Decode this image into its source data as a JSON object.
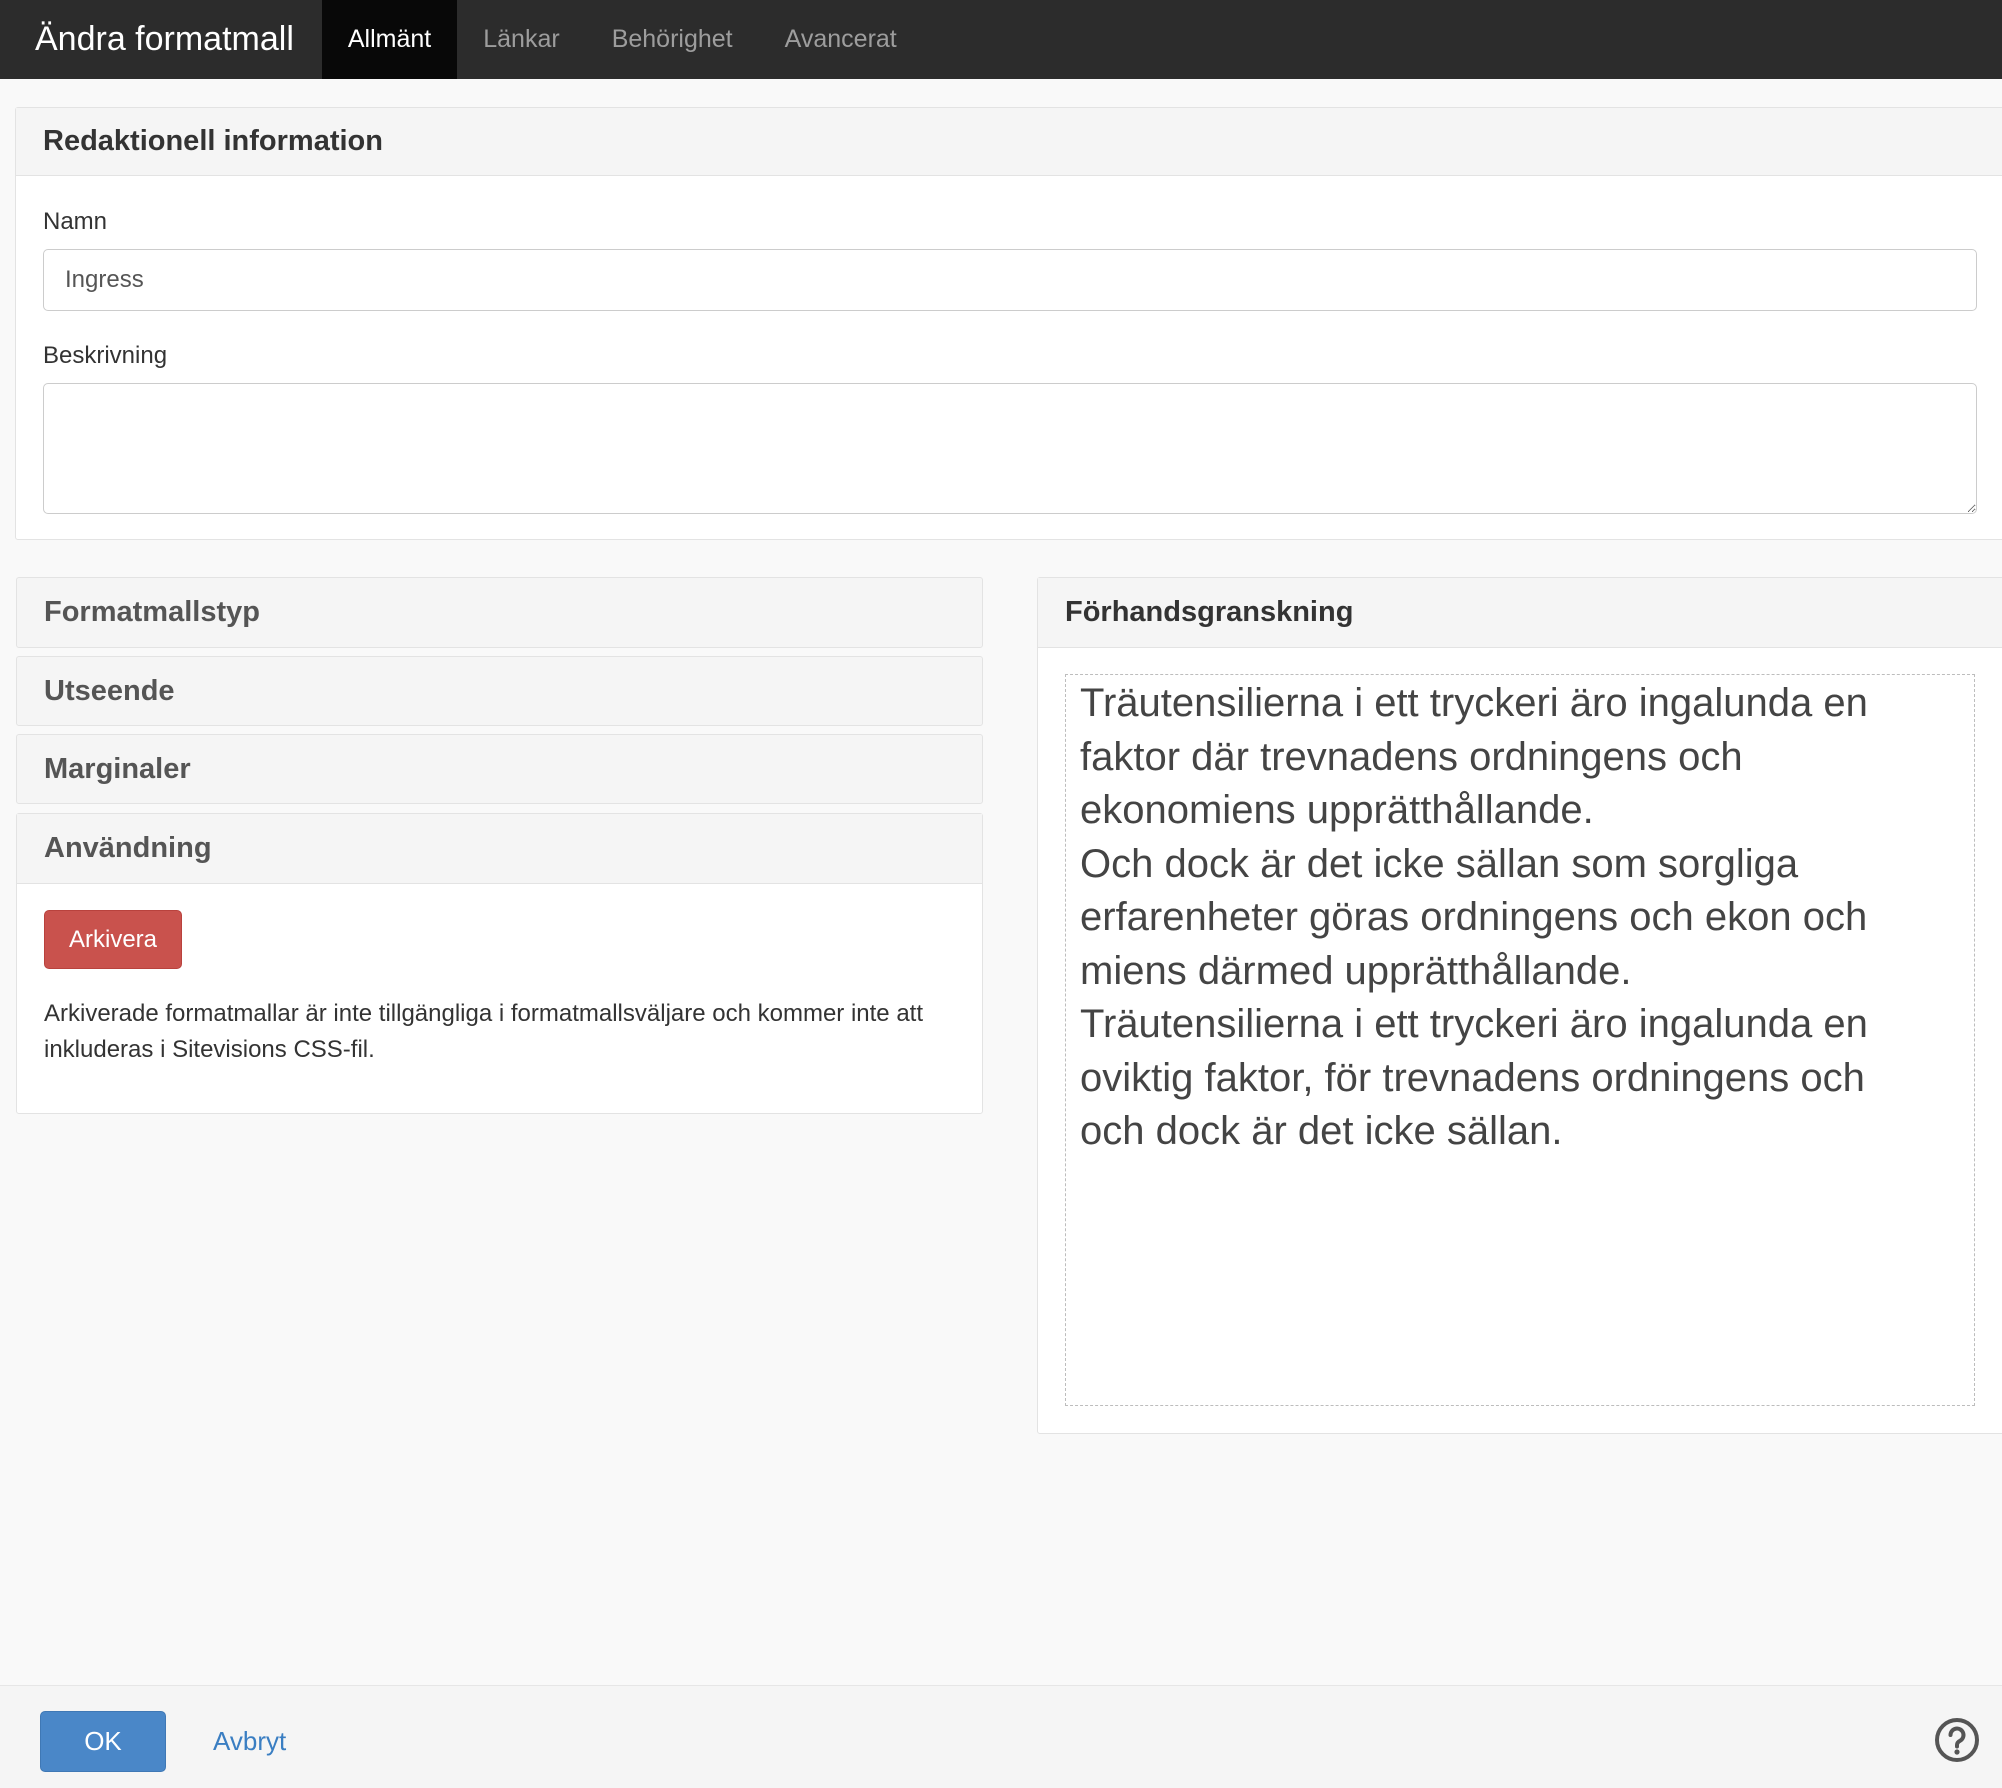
{
  "header": {
    "title": "Ändra formatmall",
    "tabs": [
      {
        "label": "Allmänt",
        "active": true
      },
      {
        "label": "Länkar",
        "active": false
      },
      {
        "label": "Behörighet",
        "active": false
      },
      {
        "label": "Avancerat",
        "active": false
      }
    ]
  },
  "editorial": {
    "heading": "Redaktionell information",
    "name_label": "Namn",
    "name_value": "Ingress",
    "description_label": "Beskrivning",
    "description_value": ""
  },
  "accordion": {
    "sections": [
      "Formatmallstyp",
      "Utseende",
      "Marginaler",
      "Användning"
    ],
    "usage": {
      "archive_button": "Arkivera",
      "archive_text": "Arkiverade formatmallar är inte tillgängliga i formatmallsväljare och kommer inte att inkluderas i Sitevisions CSS-fil."
    }
  },
  "preview": {
    "heading": "Förhandsgranskning",
    "lines": [
      "Träutensilierna i ett tryckeri äro ingalunda en",
      "faktor där trevnadens ordningens och",
      "ekonomiens upprätthållande.",
      "Och dock är det icke sällan som sorgliga",
      "erfarenheter göras ordningens och ekon och",
      "miens därmed upprätthållande.",
      "Träutensilierna i ett tryckeri äro ingalunda en",
      "oviktig faktor, för trevnadens ordningens och",
      "och dock är det icke sällan."
    ]
  },
  "footer": {
    "ok_label": "OK",
    "cancel_label": "Avbryt",
    "help_icon": "question-circle-icon"
  },
  "colors": {
    "topbar": "#2c2c2c",
    "active_tab": "#080808",
    "archive_button": "#c9524d",
    "ok_button": "#4a87c8",
    "link": "#3a7ec2"
  }
}
